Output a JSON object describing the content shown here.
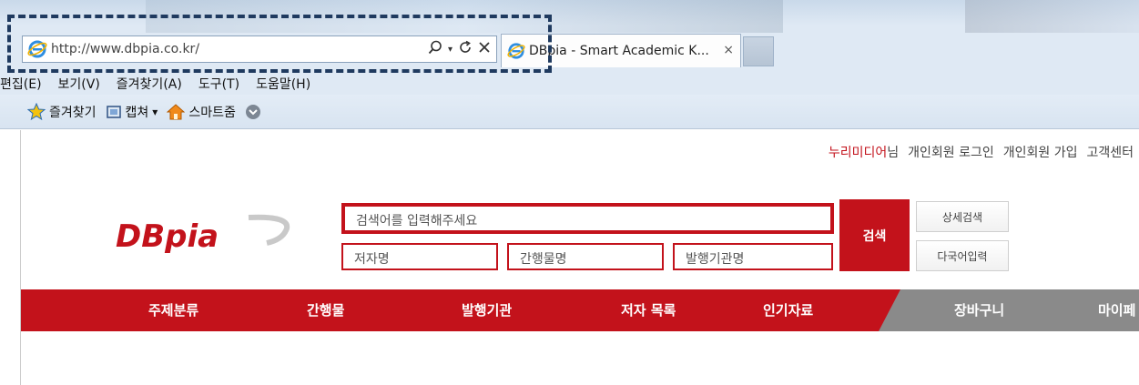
{
  "browser": {
    "address_url": "http://www.dbpia.co.kr/",
    "address_icons": {
      "search": "search-icon",
      "dropdown": "dropdown-arrow-icon",
      "refresh": "refresh-icon",
      "stop": "stop-icon"
    },
    "tab_title": "DBpia - Smart Academic K...",
    "tab_close": "×"
  },
  "menu": [
    "편집(E)",
    "보기(V)",
    "즐겨찾기(A)",
    "도구(T)",
    "도움말(H)"
  ],
  "favorites_bar": {
    "favorites": "즐겨찾기",
    "capture": "캡쳐",
    "capture_arrow": "▾",
    "smart_zoom": "스마트줌"
  },
  "page": {
    "top_links": {
      "user_name": "누리미디어",
      "user_suffix": "님",
      "login": "개인회원 로그인",
      "signup": "개인회원 가입",
      "support": "고객센터"
    },
    "logo_text": "DBpia",
    "search": {
      "main_placeholder": "검색어를 입력해주세요",
      "author_placeholder": "저자명",
      "journal_placeholder": "간행물명",
      "publisher_placeholder": "발행기관명",
      "search_button": "검색",
      "advanced_button": "상세검색",
      "multilang_button": "다국어입력"
    },
    "nav": [
      "주제분류",
      "간행물",
      "발행기관",
      "저자 목록",
      "인기자료",
      "장바구니",
      "마이페"
    ]
  },
  "colors": {
    "brand_red": "#c3121b",
    "nav_gray": "#8a8a8a",
    "highlight": "#1f3a5f"
  }
}
